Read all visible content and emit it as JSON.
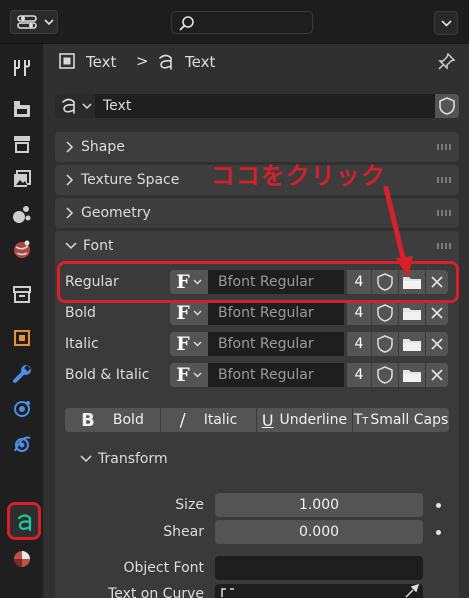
{
  "header": {
    "search_placeholder": ""
  },
  "breadcrumb": {
    "item1": "Text",
    "separator": ">",
    "item2": "Text"
  },
  "datablock": {
    "name": "Text"
  },
  "sections": {
    "shape": "Shape",
    "texture_space": "Texture Space",
    "geometry": "Geometry",
    "font": "Font"
  },
  "annotation": {
    "text": "ココをクリック",
    "color": "#d6202a"
  },
  "fonts": [
    {
      "label": "Regular",
      "font_name": "Bfont Regular",
      "users": "4"
    },
    {
      "label": "Bold",
      "font_name": "Bfont Regular",
      "users": "4"
    },
    {
      "label": "Italic",
      "font_name": "Bfont Regular",
      "users": "4"
    },
    {
      "label": "Bold & Italic",
      "font_name": "Bfont Regular",
      "users": "4"
    }
  ],
  "styles": {
    "bold": "Bold",
    "italic": "Italic",
    "underline": "Underline",
    "small_caps": "Small Caps"
  },
  "transform": {
    "title": "Transform",
    "size_label": "Size",
    "size_value": "1.000",
    "shear_label": "Shear",
    "shear_value": "0.000",
    "object_font_label": "Object Font",
    "text_on_curve_label": "Text on Curve"
  },
  "icons": {
    "sidebar": [
      "tool-icon",
      "render-icon",
      "output-icon",
      "view-layer-icon",
      "scene-icon",
      "world-icon",
      "collection-icon",
      "object-icon",
      "modifier-icon",
      "particles-icon",
      "physics-icon",
      "data-text-icon",
      "material-icon"
    ]
  },
  "colors": {
    "accent_active": "#1ec8a0",
    "highlight": "#d6202a"
  }
}
